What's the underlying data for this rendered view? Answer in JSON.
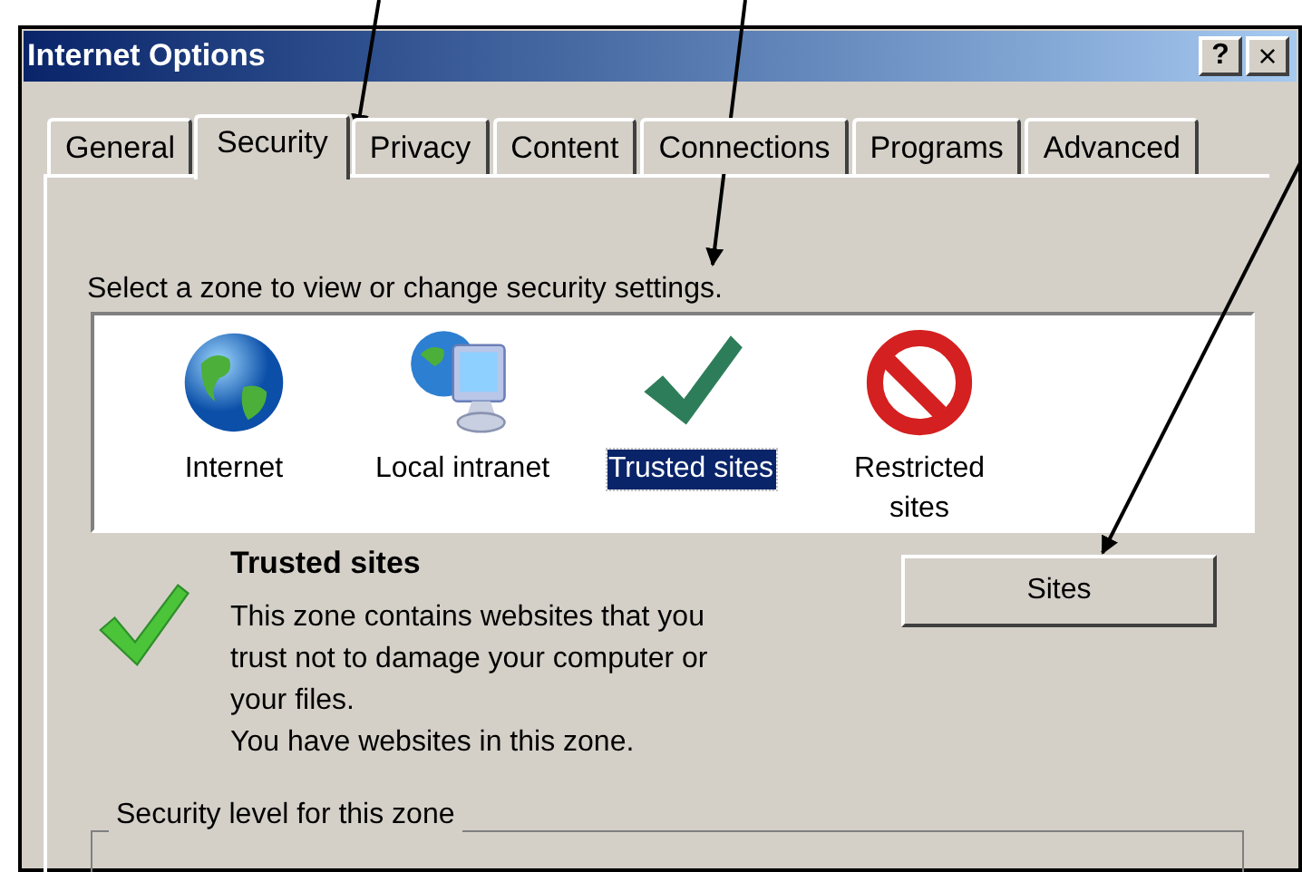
{
  "window": {
    "title": "Internet Options",
    "buttons": [
      {
        "kind": "help",
        "label": "?"
      },
      {
        "kind": "close",
        "label": "×"
      }
    ]
  },
  "tabs": [
    {
      "label": "General",
      "selected": false
    },
    {
      "label": "Security",
      "selected": true
    },
    {
      "label": "Privacy",
      "selected": false
    },
    {
      "label": "Content",
      "selected": false
    },
    {
      "label": "Connections",
      "selected": false
    },
    {
      "label": "Programs",
      "selected": false
    },
    {
      "label": "Advanced",
      "selected": false
    }
  ],
  "zone_prompt": "Select a zone to view or change security settings.",
  "zones": [
    {
      "label": "Internet",
      "kind": "globe",
      "selected": false
    },
    {
      "label": "Local intranet",
      "kind": "globe-monitor",
      "selected": false
    },
    {
      "label": "Trusted sites",
      "kind": "check",
      "selected": true
    },
    {
      "label": "Restricted sites",
      "kind": "no-sign",
      "selected": false
    }
  ],
  "zone_info": {
    "title": "Trusted sites",
    "description": "This zone contains websites that you trust not to damage your computer or your files.",
    "status": "You have websites in this zone."
  },
  "sites_button": "Sites",
  "security_level": {
    "legend": "Security level for this zone"
  }
}
